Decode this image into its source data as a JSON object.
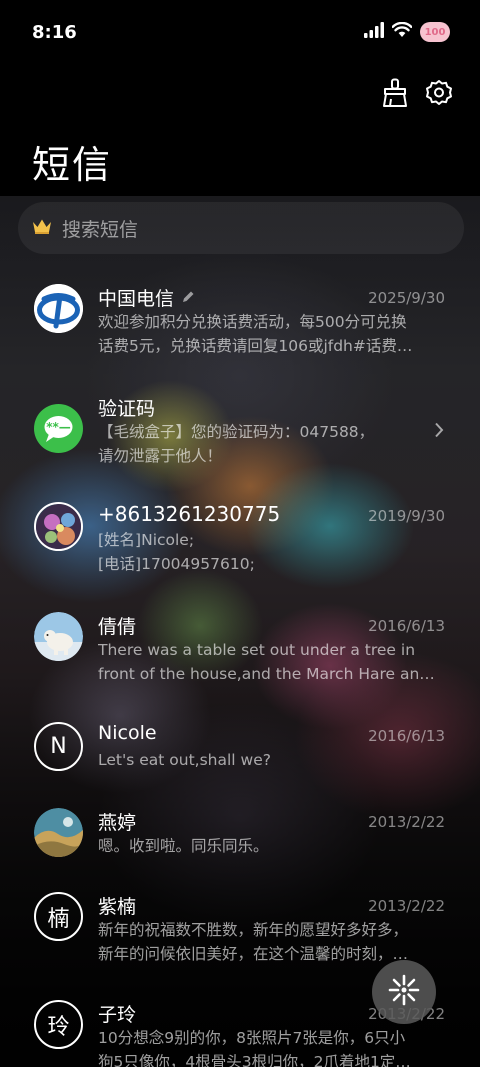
{
  "status": {
    "time": "8:16",
    "battery_label": "100",
    "icons": [
      "signal-icon",
      "wifi-icon",
      "battery-icon"
    ]
  },
  "toolbar": {
    "clean_icon": "broom-icon",
    "settings_icon": "gear-icon"
  },
  "title": "短信",
  "search": {
    "placeholder": "搜索短信",
    "icon": "crown-icon"
  },
  "messages": [
    {
      "sender": "中国电信",
      "date": "2025/9/30",
      "lines": [
        "欢迎参加积分兑换话费活动，每500分可兑换",
        "话费5元，兑换话费请回复106或jfdh#话费…"
      ],
      "avatar": "china-telecom-logo",
      "accent": "#1b63b6"
    },
    {
      "sender": "验证码",
      "date": "",
      "lines": [
        "【毛绒盒子】您的验证码为：047588，",
        "请勿泄露于他人！"
      ],
      "avatar": "message-bubble-icon",
      "accent": "#3cbf4a"
    },
    {
      "sender": "+8613261230775",
      "date": "2019/9/30",
      "lines": [
        "[姓名]Nicole;",
        "[电话]17004957610;"
      ],
      "avatar": "photo-avatar"
    },
    {
      "sender": "倩倩",
      "date": "2016/6/13",
      "lines": [
        "There was a table set out under a tree in",
        "front of the house,and the March Hare an…"
      ],
      "avatar": "polar-bear-avatar"
    },
    {
      "sender": "Nicole",
      "date": "2016/6/13",
      "lines": [
        "Let's eat out,shall we?"
      ],
      "avatar_letter": "N"
    },
    {
      "sender": "燕婷",
      "date": "2013/2/22",
      "lines": [
        "嗯。收到啦。同乐同乐。"
      ],
      "avatar": "landscape-avatar"
    },
    {
      "sender": "紫楠",
      "date": "2013/2/22",
      "lines": [
        "新年的祝福数不胜数，新年的愿望好多好多，",
        "新年的问候依旧美好，在这个温馨的时刻，…"
      ],
      "avatar_letter": "楠"
    },
    {
      "sender": "子玲",
      "date": "2013/2/22",
      "lines": [
        "10分想念9别的你，8张照片7张是你，6只小",
        "狗5只像你，4根骨头3根归你，2爪着地1定…"
      ],
      "avatar_letter": "玲"
    }
  ],
  "fab_icon": "firework-icon"
}
